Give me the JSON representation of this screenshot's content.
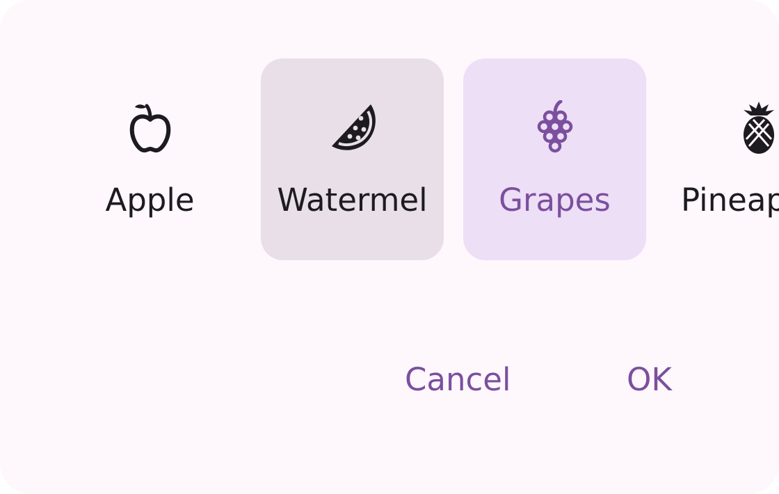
{
  "options": [
    {
      "label": "Apple",
      "icon": "apple-icon",
      "selected": false
    },
    {
      "label": "Watermel",
      "icon": "watermelon-icon",
      "selected": false,
      "hovered": true
    },
    {
      "label": "Grapes",
      "icon": "grapes-icon",
      "selected": true
    },
    {
      "label": "Pineap",
      "icon": "pineapple-icon",
      "selected": false
    }
  ],
  "actions": {
    "cancel_label": "Cancel",
    "ok_label": "OK"
  },
  "colors": {
    "surface": "#fef7fc",
    "on_surface": "#1d1b20",
    "primary": "#7b4f9e",
    "selected_container": "#eddff6",
    "hover_container": "#e8dfe8"
  }
}
